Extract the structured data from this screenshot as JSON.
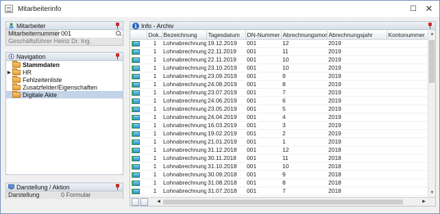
{
  "window": {
    "title": "Mitarbeiterinfo",
    "maximize_glyph": "☐",
    "close_glyph": "✕"
  },
  "mitarbeiter": {
    "header": "Mitarbeiter",
    "fields": [
      {
        "label": "Mitarbeiternummer",
        "value": "001"
      }
    ],
    "name": "Geschäftsführer Heinz Dr.  Ing."
  },
  "navigation": {
    "header": "Navigation",
    "items": [
      {
        "label": "Stammdaten",
        "bold": true,
        "expander": ""
      },
      {
        "label": "HR",
        "bold": false,
        "expander": "▶"
      },
      {
        "label": "Fehlzeitenliste",
        "bold": false,
        "expander": ""
      },
      {
        "label": "Zusatzfelder/Eigenschaften",
        "bold": false,
        "expander": ""
      },
      {
        "label": "Digitale Akte",
        "bold": false,
        "expander": "",
        "selected": true
      }
    ]
  },
  "darstellung": {
    "header": "Darstellung / Aktion",
    "label": "Darstellung",
    "value": "0 Formular"
  },
  "info": {
    "header": "Info - Archiv",
    "columns": [
      "",
      "Dok...",
      "Bezeichnung",
      "Tagesdatum",
      "DN-Nummer",
      "Abrechnungsmonat",
      "Abrechnungsjahr",
      "Kontonummer"
    ],
    "rows": [
      [
        "1",
        "Lohnabrechnung",
        "19.12.2019",
        "001",
        "12",
        "2019",
        ""
      ],
      [
        "1",
        "Lohnabrechnung",
        "22.11.2019",
        "001",
        "11",
        "2019",
        ""
      ],
      [
        "1",
        "Lohnabrechnung",
        "22.11.2019",
        "001",
        "10",
        "2019",
        ""
      ],
      [
        "1",
        "Lohnabrechnung",
        "23.10.2019",
        "001",
        "10",
        "2019",
        ""
      ],
      [
        "1",
        "Lohnabrechnung",
        "23.09.2019",
        "001",
        "9",
        "2019",
        ""
      ],
      [
        "1",
        "Lohnabrechnung",
        "24.08.2019",
        "001",
        "8",
        "2019",
        ""
      ],
      [
        "1",
        "Lohnabrechnung",
        "23.07.2019",
        "001",
        "7",
        "2019",
        ""
      ],
      [
        "1",
        "Lohnabrechnung",
        "24.06.2019",
        "001",
        "6",
        "2019",
        ""
      ],
      [
        "1",
        "Lohnabrechnung",
        "23.05.2019",
        "001",
        "5",
        "2019",
        ""
      ],
      [
        "1",
        "Lohnabrechnung",
        "24.04.2019",
        "001",
        "4",
        "2019",
        ""
      ],
      [
        "1",
        "Lohnabrechnung",
        "16.03.2019",
        "001",
        "3",
        "2019",
        ""
      ],
      [
        "1",
        "Lohnabrechnung",
        "19.02.2019",
        "001",
        "2",
        "2019",
        ""
      ],
      [
        "1",
        "Lohnabrechnung",
        "21.01.2019",
        "001",
        "1",
        "2019",
        ""
      ],
      [
        "1",
        "Lohnabrechnung",
        "31.12.2018",
        "001",
        "12",
        "2018",
        ""
      ],
      [
        "1",
        "Lohnabrechnung",
        "30.11.2018",
        "001",
        "11",
        "2018",
        ""
      ],
      [
        "1",
        "Lohnabrechnung",
        "31.10.2018",
        "001",
        "10",
        "2018",
        ""
      ],
      [
        "1",
        "Lohnabrechnung",
        "30.09.2018",
        "001",
        "9",
        "2018",
        ""
      ],
      [
        "1",
        "Lohnabrechnung",
        "31.08.2018",
        "001",
        "8",
        "2018",
        ""
      ],
      [
        "1",
        "Lohnabrechnung",
        "31.07.2018",
        "001",
        "7",
        "2018",
        ""
      ]
    ],
    "scroll_up_glyph": "▲",
    "scroll_down_glyph": "▼",
    "scroll_left_glyph": "◀",
    "scroll_right_glyph": "▶"
  }
}
